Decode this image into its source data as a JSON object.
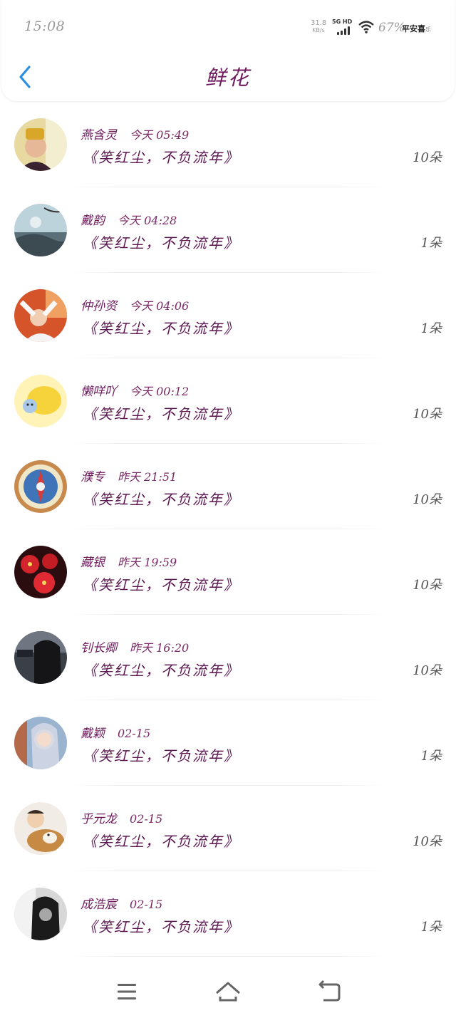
{
  "status_bar": {
    "time": "15:08",
    "net_speed_value": "31.8",
    "net_speed_unit": "KB/s",
    "network_type": "5G HD",
    "battery": "67%",
    "carrier": "平安喜",
    "carrier_suffix": "乐",
    "icons": [
      "signal-icon",
      "wifi-icon"
    ]
  },
  "header": {
    "title": "鲜花",
    "back_icon": "chevron-left-icon",
    "accent_color": "#2a8fe0",
    "title_color": "#6e1a5e"
  },
  "gifts": [
    {
      "name": "燕含灵",
      "time": "今天 05:49",
      "gift": "《笑红尘，不负流年》",
      "count": "10朵",
      "avatar": "avatar-girl-hat"
    },
    {
      "name": "戴韵",
      "time": "今天 04:28",
      "gift": "《笑红尘，不负流年》",
      "count": "1朵",
      "avatar": "avatar-landscape"
    },
    {
      "name": "仲孙资",
      "time": "今天 04:06",
      "gift": "《笑红尘，不负流年》",
      "count": "1朵",
      "avatar": "avatar-person-red"
    },
    {
      "name": "懒咩吖",
      "time": "今天 00:12",
      "gift": "《笑红尘，不负流年》",
      "count": "10朵",
      "avatar": "avatar-lemon"
    },
    {
      "name": "濮专",
      "time": "昨天 21:51",
      "gift": "《笑红尘，不负流年》",
      "count": "10朵",
      "avatar": "avatar-emblem"
    },
    {
      "name": "藏银",
      "time": "昨天 19:59",
      "gift": "《笑红尘，不负流年》",
      "count": "10朵",
      "avatar": "avatar-red-flowers"
    },
    {
      "name": "钊长卿",
      "time": "昨天 16:20",
      "gift": "《笑红尘，不负流年》",
      "count": "10朵",
      "avatar": "avatar-dark-hair"
    },
    {
      "name": "戴颖",
      "time": "02-15",
      "gift": "《笑红尘，不负流年》",
      "count": "1朵",
      "avatar": "avatar-anime-girl"
    },
    {
      "name": "乎元龙",
      "time": "02-15",
      "gift": "《笑红尘，不负流年》",
      "count": "10朵",
      "avatar": "avatar-child-dog"
    },
    {
      "name": "成浩宸",
      "time": "02-15",
      "gift": "《笑红尘，不负流年》",
      "count": "1朵",
      "avatar": "avatar-bw-woman"
    }
  ],
  "nav_bar": {
    "icons": [
      "menu-icon",
      "home-icon",
      "back-icon"
    ]
  }
}
